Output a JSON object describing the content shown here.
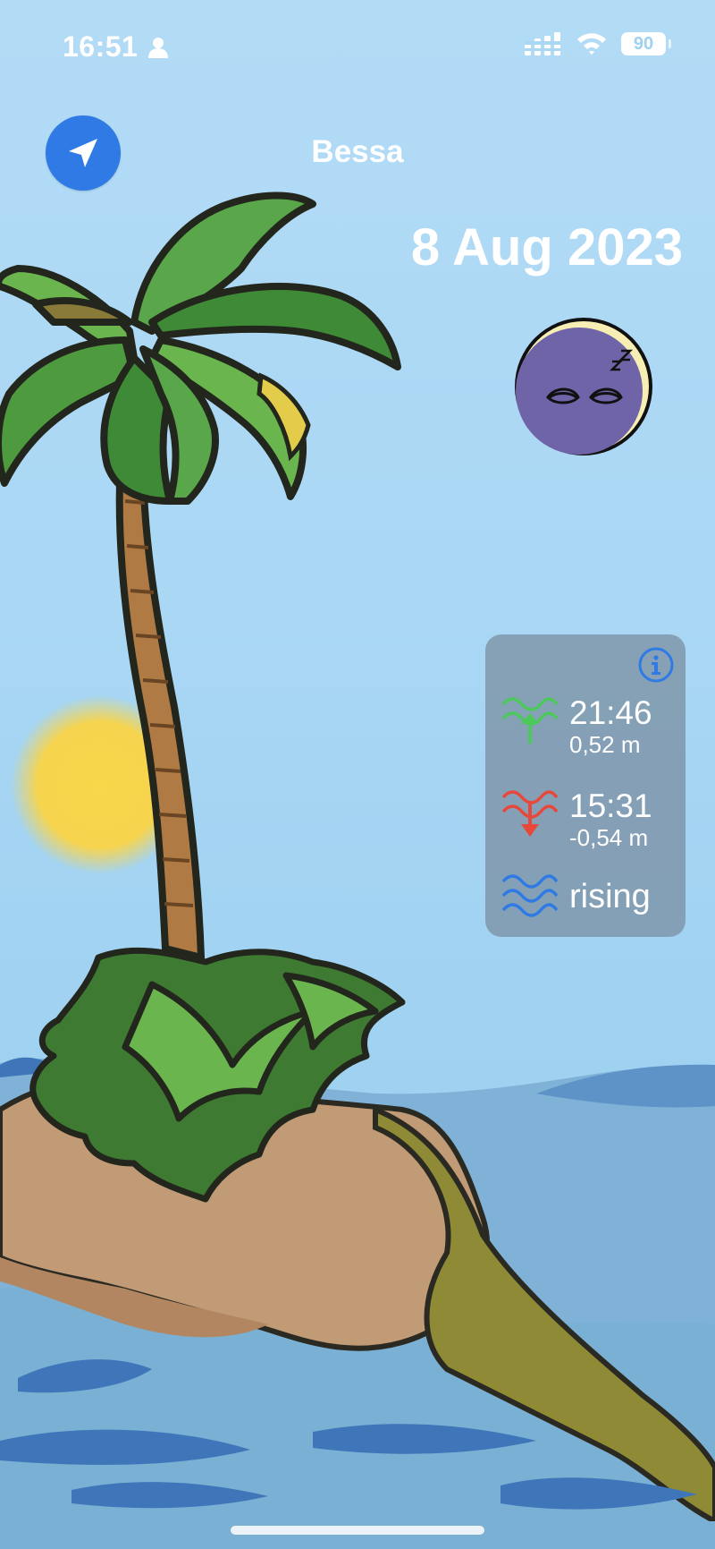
{
  "status_bar": {
    "time": "16:51",
    "battery": "90"
  },
  "header": {
    "location": "Bessa",
    "date": "8 Aug 2023"
  },
  "moon": {
    "icon": "sleeping-moon-icon"
  },
  "tide": {
    "high": {
      "time": "21:46",
      "height": "0,52 m"
    },
    "low": {
      "time": "15:31",
      "height": "-0,54 m"
    },
    "status": "rising"
  },
  "colors": {
    "accent_blue": "#2f7ae5",
    "high_tide_green": "#4cc95a",
    "low_tide_red": "#e8483a",
    "wave_blue": "#2f7ae5"
  }
}
